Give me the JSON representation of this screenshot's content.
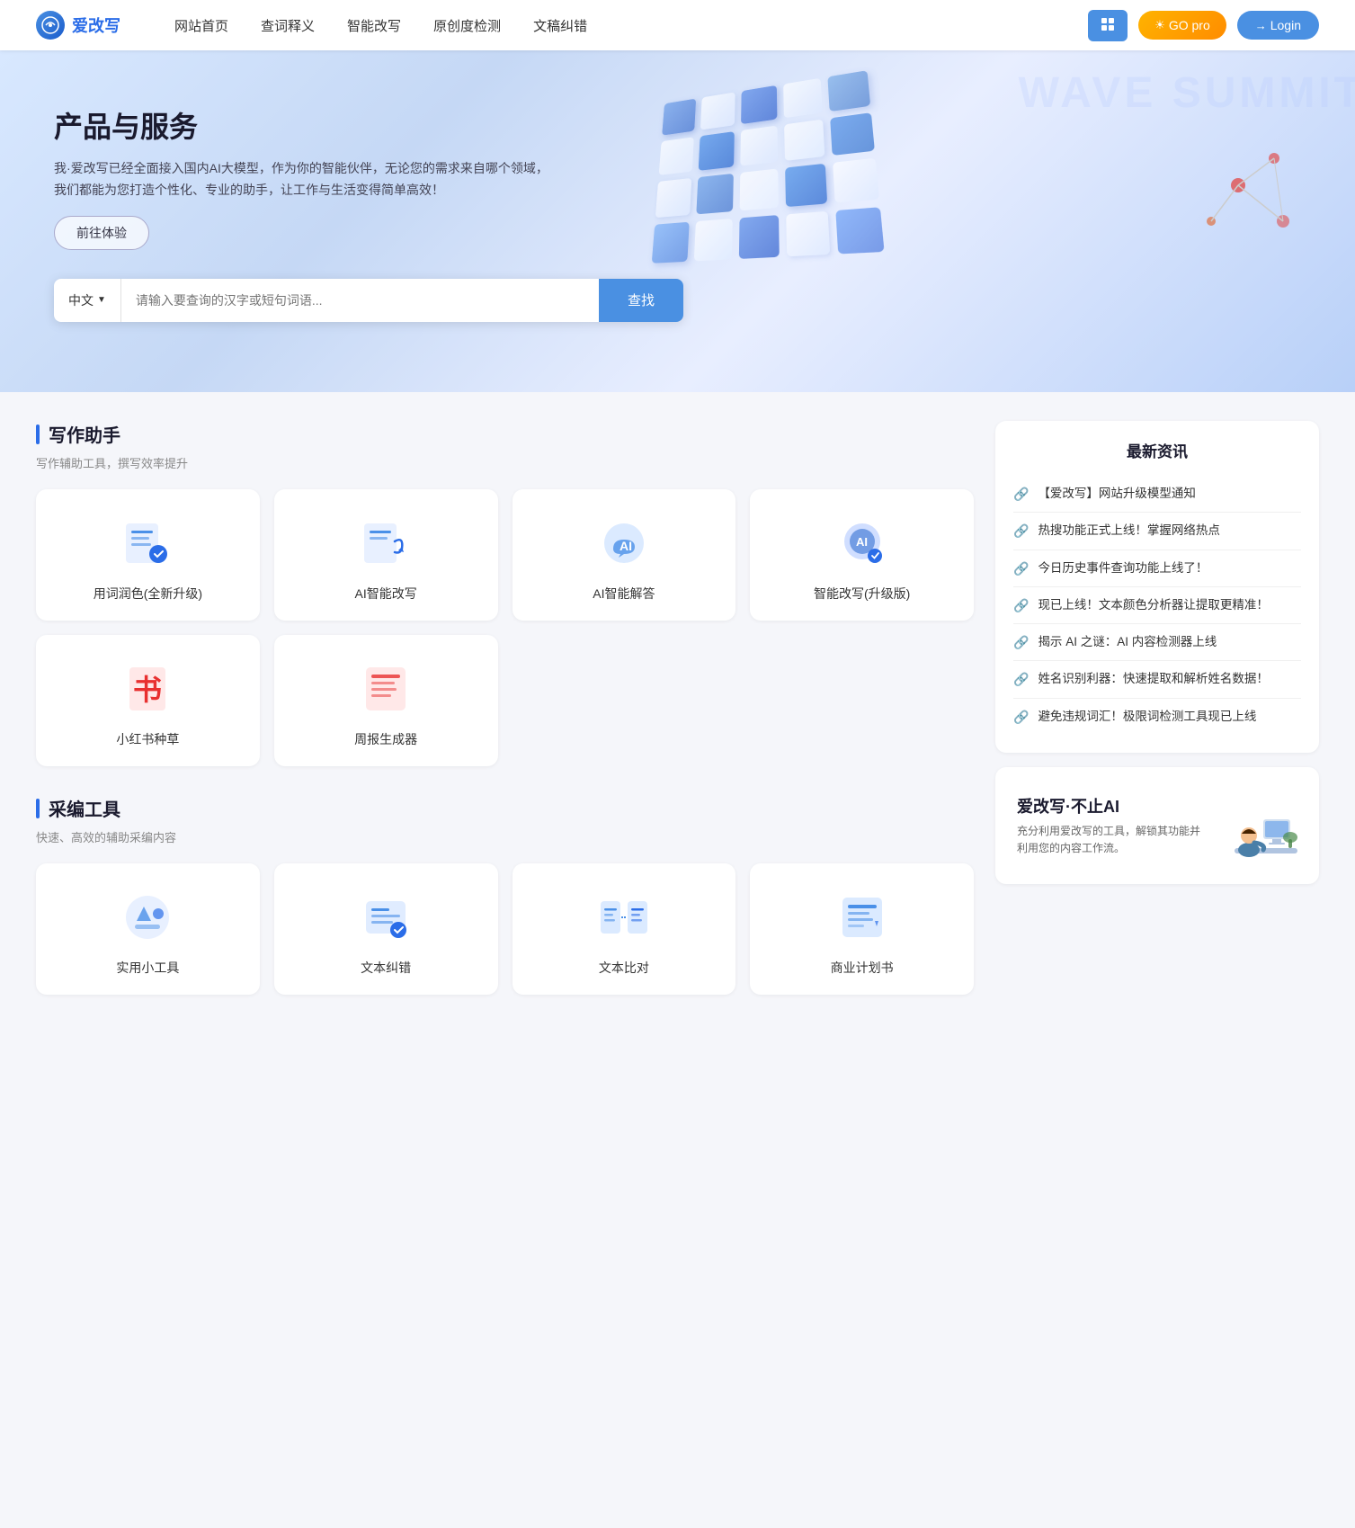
{
  "site": {
    "logo_text": "爱改写",
    "logo_icon": "✎"
  },
  "navbar": {
    "links": [
      {
        "label": "网站首页",
        "href": "#"
      },
      {
        "label": "查词释义",
        "href": "#"
      },
      {
        "label": "智能改写",
        "href": "#"
      },
      {
        "label": "原创度检测",
        "href": "#"
      },
      {
        "label": "文稿纠错",
        "href": "#"
      }
    ],
    "btn_grid_label": "⊞",
    "btn_go_pro_label": "GO pro",
    "btn_login_label": "Login"
  },
  "hero": {
    "title": "产品与服务",
    "desc": "我·爱改写已经全面接入国内AI大模型，作为你的智能伙伴，无论您的需求来自哪个领域，我们都能为您打造个性化、专业的助手，让工作与生活变得简单高效！",
    "cta_label": "前往体验",
    "search_lang": "中文",
    "search_placeholder": "请输入要查询的汉字或短句词语...",
    "search_btn_label": "查找"
  },
  "writing_tools": {
    "section_title": "写作助手",
    "section_subtitle": "写作辅助工具，撰写效率提升",
    "tools": [
      {
        "id": "word-polish",
        "label": "用词润色(全新升级)",
        "icon_type": "document-edit-blue"
      },
      {
        "id": "ai-rewrite",
        "label": "AI智能改写",
        "icon_type": "ai-rewrite-blue"
      },
      {
        "id": "ai-answer",
        "label": "AI智能解答",
        "icon_type": "ai-chat-blue"
      },
      {
        "id": "smart-rewrite-pro",
        "label": "智能改写(升级版)",
        "icon_type": "ai-upgrade-blue"
      },
      {
        "id": "xiaohongshu",
        "label": "小红书种草",
        "icon_type": "book-red"
      },
      {
        "id": "weekly-report",
        "label": "周报生成器",
        "icon_type": "report-red"
      }
    ]
  },
  "curation_tools": {
    "section_title": "采编工具",
    "section_subtitle": "快速、高效的辅助采编内容",
    "tools": [
      {
        "id": "utility-tools",
        "label": "实用小工具",
        "icon_type": "tools-blue"
      },
      {
        "id": "text-correct",
        "label": "文本纠错",
        "icon_type": "text-correct-blue"
      },
      {
        "id": "text-compare",
        "label": "文本比对",
        "icon_type": "text-compare-blue"
      },
      {
        "id": "biz-plan",
        "label": "商业计划书",
        "icon_type": "biz-plan-blue"
      }
    ]
  },
  "news": {
    "section_title": "最新资讯",
    "items": [
      {
        "text": "【爱改写】网站升级模型通知"
      },
      {
        "text": "热搜功能正式上线！掌握网络热点"
      },
      {
        "text": "今日历史事件查询功能上线了！"
      },
      {
        "text": "现已上线！文本颜色分析器让提取更精准！"
      },
      {
        "text": "揭示 AI 之谜：AI 内容检测器上线"
      },
      {
        "text": "姓名识别利器：快速提取和解析姓名数据！"
      },
      {
        "text": "避免违规词汇！极限词检测工具现已上线"
      }
    ]
  },
  "promo": {
    "brand_text": "爱改写·不止AI",
    "desc_text": "充分利用爱改写的工具，解锁其功能并利用您的内容工作流。"
  }
}
